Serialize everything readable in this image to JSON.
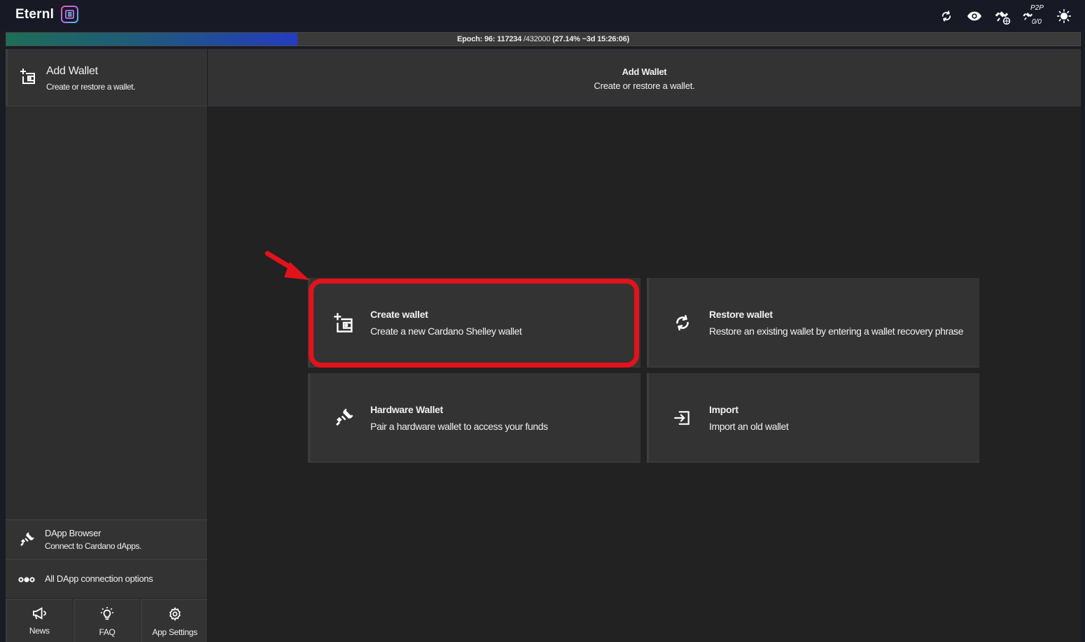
{
  "app": {
    "name": "Eternl"
  },
  "header": {
    "icons": [
      "sync-icon",
      "eye-icon",
      "satellite-globe-icon",
      "satellite-p2p-icon",
      "sun-icon"
    ],
    "p2p_label": "P2P",
    "p2p_count": "0/0"
  },
  "epoch": {
    "prefix": "Epoch: 96: 117234",
    "total": "/432000",
    "detail": "(27.14% ~3d 15:26:06)",
    "progress_fraction": 0.2714
  },
  "sidebar": {
    "header": {
      "title": "Add Wallet",
      "subtitle": "Create or restore a wallet.",
      "icon": "add-wallet-icon"
    },
    "dapp_browser": {
      "title": "DApp Browser",
      "subtitle": "Connect to Cardano dApps.",
      "icon": "plug-icon"
    },
    "dapp_options": {
      "title": "All DApp connection options",
      "icon": "connection-dots-icon"
    },
    "bottom_nav": [
      {
        "label": "News",
        "icon": "megaphone-icon"
      },
      {
        "label": "FAQ",
        "icon": "lightbulb-icon"
      },
      {
        "label": "App Settings",
        "icon": "gear-icon"
      }
    ]
  },
  "main": {
    "title": "Add Wallet",
    "subtitle": "Create or restore a wallet.",
    "cards": [
      {
        "title": "Create wallet",
        "subtitle": "Create a new Cardano Shelley wallet",
        "icon": "add-wallet-icon"
      },
      {
        "title": "Restore wallet",
        "subtitle": "Restore an existing wallet by entering a wallet recovery phrase",
        "icon": "sync-icon"
      },
      {
        "title": "Hardware Wallet",
        "subtitle": "Pair a hardware wallet to access your funds",
        "icon": "plug-icon"
      },
      {
        "title": "Import",
        "subtitle": "Import an old wallet",
        "icon": "import-icon"
      }
    ]
  },
  "colors": {
    "highlight": "#e4121b",
    "accent_blue": "#243cbf",
    "accent_green": "#1d6e57"
  }
}
